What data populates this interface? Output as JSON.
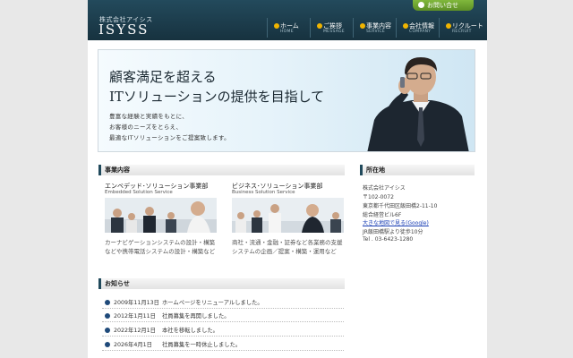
{
  "header": {
    "company_name_small": "株式会社アイシス",
    "logo_text": "ISYSS",
    "contact_tab": "お問い合せ",
    "nav": [
      {
        "label": "ホーム",
        "sub": "HOME"
      },
      {
        "label": "ご挨拶",
        "sub": "MESSAGE"
      },
      {
        "label": "事業内容",
        "sub": "SERVICE"
      },
      {
        "label": "会社情報",
        "sub": "COMPANY"
      },
      {
        "label": "リクルート",
        "sub": "RECRUIT"
      }
    ]
  },
  "hero": {
    "title_line1": "顧客満足を超える",
    "title_line2": "ITソリューションの提供を目指して",
    "text_lines": [
      "豊富な経験と実績をもとに、",
      "お客様のニーズをとらえ、",
      "最適なITソリューションをご提案致します。"
    ]
  },
  "business": {
    "heading": "事業内容",
    "columns": [
      {
        "title": "エンベデッド･ソリューション事業部",
        "subtitle": "Embedded Solution Service",
        "desc": "カーナビゲーションシステムの設計・構築などや携帯電話システムの設計・構築など"
      },
      {
        "title": "ビジネス･ソリューション事業部",
        "subtitle": "Business Solution Service",
        "desc": "商社・流通・金融・証券など各業務の支援システムの企画／提案・構築・運用など"
      }
    ]
  },
  "location": {
    "heading": "所在地",
    "company": "株式会社アイシス",
    "postal": "〒102-0072",
    "address1": "東京都千代田区飯田橋2-11-10",
    "address2": "総合経営ビル6F",
    "map_link": "大きな地図で見る(Google)",
    "access": "JR飯田橋駅より徒歩10分",
    "tel": "Tel . 03-6423-1280"
  },
  "news": {
    "heading": "お知らせ",
    "items": [
      {
        "date": "2009年11月13日",
        "title": "ホームページをリニューアルしました。"
      },
      {
        "date": "2012年1月11日",
        "title": "社員募集を再開しました。"
      },
      {
        "date": "2022年12月1日",
        "title": "本社を移転しました。"
      },
      {
        "date": "2026年4月1日",
        "title": "社員募集を一時休止しました。"
      }
    ]
  },
  "colors": {
    "header_bg": "#1f3f4f",
    "nav_dot": "#f0b400",
    "contact_green": "#6a9e2c",
    "link_blue": "#1a3fb5"
  }
}
